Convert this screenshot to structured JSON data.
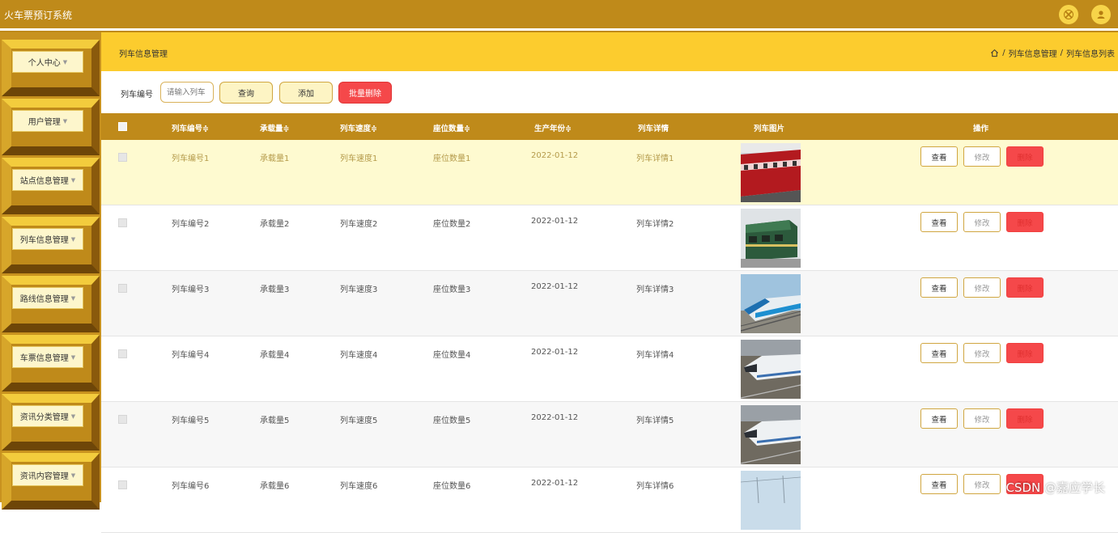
{
  "app": {
    "title": "火车票预订系统"
  },
  "header_icons": [
    "close-icon",
    "user-icon"
  ],
  "sidebar": {
    "items": [
      {
        "label": "个人中心"
      },
      {
        "label": "用户管理"
      },
      {
        "label": "站点信息管理"
      },
      {
        "label": "列车信息管理"
      },
      {
        "label": "路线信息管理"
      },
      {
        "label": "车票信息管理"
      },
      {
        "label": "资讯分类管理"
      },
      {
        "label": "资讯内容管理"
      }
    ]
  },
  "page": {
    "title": "列车信息管理",
    "breadcrumb": [
      "列车信息管理",
      "列车信息列表"
    ],
    "breadcrumb_sep": "/"
  },
  "search": {
    "label": "列车编号",
    "placeholder": "请输入列车",
    "query_button": "查询",
    "add_button": "添加",
    "batch_delete_button": "批量删除"
  },
  "table": {
    "columns": [
      "列车编号",
      "承载量",
      "列车速度",
      "座位数量",
      "生产年份",
      "列车详情",
      "列车图片",
      "操作"
    ],
    "sortable_suffix": "≑",
    "rows": [
      {
        "train_no": "列车编号1",
        "capacity": "承载量1",
        "speed": "列车速度1",
        "seats": "座位数量1",
        "year": "2022-01-12",
        "detail": "列车详情1",
        "image": "red-train"
      },
      {
        "train_no": "列车编号2",
        "capacity": "承载量2",
        "speed": "列车速度2",
        "seats": "座位数量2",
        "year": "2022-01-12",
        "detail": "列车详情2",
        "image": "green-locomotive"
      },
      {
        "train_no": "列车编号3",
        "capacity": "承载量3",
        "speed": "列车速度3",
        "seats": "座位数量3",
        "year": "2022-01-12",
        "detail": "列车详情3",
        "image": "blue-emu"
      },
      {
        "train_no": "列车编号4",
        "capacity": "承载量4",
        "speed": "列车速度4",
        "seats": "座位数量4",
        "year": "2022-01-12",
        "detail": "列车详情4",
        "image": "white-bullet-train"
      },
      {
        "train_no": "列车编号5",
        "capacity": "承载量5",
        "speed": "列车速度5",
        "seats": "座位数量5",
        "year": "2022-01-12",
        "detail": "列车详情5",
        "image": "white-bullet-train"
      },
      {
        "train_no": "列车编号6",
        "capacity": "承载量6",
        "speed": "列车速度6",
        "seats": "座位数量6",
        "year": "2022-01-12",
        "detail": "列车详情6",
        "image": "sky-wires"
      }
    ],
    "actions": {
      "view": "查看",
      "edit": "修改",
      "delete": "删除"
    }
  },
  "watermark": "CSDN @嘉应学长",
  "colors": {
    "primary": "#bf8a1a",
    "header": "#fccc2e",
    "danger": "#f5484a",
    "highlight_row": "#fefad0"
  }
}
